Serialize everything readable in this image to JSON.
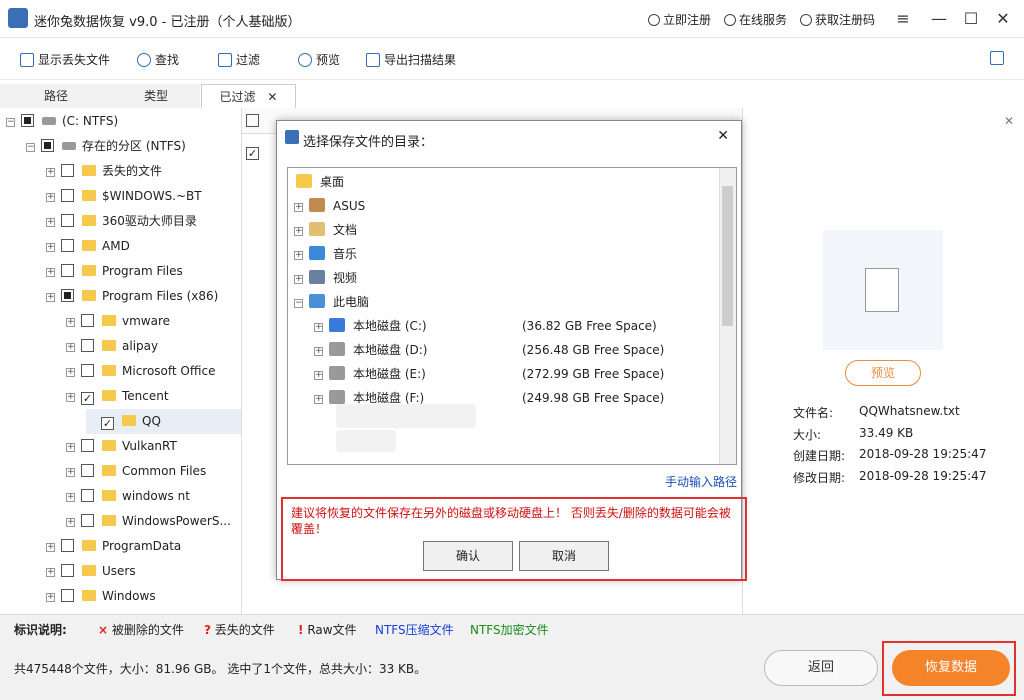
{
  "window": {
    "title": "迷你兔数据恢复  v9.0 - 已注册（个人基础版）",
    "links": [
      "立即注册",
      "在线服务",
      "获取注册码"
    ]
  },
  "toolbar": [
    "显示丢失文件",
    "查找",
    "过滤",
    "预览",
    "导出扫描结果"
  ],
  "tabs": [
    "路径",
    "类型",
    "已过滤"
  ],
  "tree": {
    "root": "(C: NTFS)",
    "partition": "存在的分区 (NTFS)",
    "items": [
      {
        "label": "丢失的文件",
        "level": 2,
        "checked": false
      },
      {
        "label": "$WINDOWS.~BT",
        "level": 2,
        "checked": false
      },
      {
        "label": "360驱动大师目录",
        "level": 2,
        "checked": false
      },
      {
        "label": "AMD",
        "level": 2,
        "checked": false
      },
      {
        "label": "Program Files",
        "level": 2,
        "checked": false
      },
      {
        "label": "Program Files (x86)",
        "level": 2,
        "checked": "partial"
      },
      {
        "label": "vmware",
        "level": 3,
        "checked": false
      },
      {
        "label": "alipay",
        "level": 3,
        "checked": false
      },
      {
        "label": "Microsoft Office",
        "level": 3,
        "checked": false
      },
      {
        "label": "Tencent",
        "level": 3,
        "checked": true
      },
      {
        "label": "QQ",
        "level": 4,
        "checked": true
      },
      {
        "label": "VulkanRT",
        "level": 3,
        "checked": false
      },
      {
        "label": "Common Files",
        "level": 3,
        "checked": false
      },
      {
        "label": "windows nt",
        "level": 3,
        "checked": false
      },
      {
        "label": "WindowsPowerS...",
        "level": 3,
        "checked": false
      },
      {
        "label": "ProgramData",
        "level": 2,
        "checked": false
      },
      {
        "label": "Users",
        "level": 2,
        "checked": false
      },
      {
        "label": "Windows",
        "level": 2,
        "checked": false
      }
    ]
  },
  "dialog": {
    "title": "选择保存文件的目录：",
    "tree": [
      {
        "label": "桌面",
        "icon": "desktop-icon",
        "free": ""
      },
      {
        "label": "ASUS",
        "icon": "user-folder-icon",
        "free": ""
      },
      {
        "label": "文档",
        "icon": "documents-icon",
        "free": ""
      },
      {
        "label": "音乐",
        "icon": "music-icon",
        "free": ""
      },
      {
        "label": "视频",
        "icon": "video-icon",
        "free": ""
      },
      {
        "label": "此电脑",
        "icon": "computer-icon",
        "free": ""
      },
      {
        "label": "本地磁盘 (C:)",
        "icon": "windows-drive-icon",
        "free": "(36.82 GB Free Space)"
      },
      {
        "label": "本地磁盘 (D:)",
        "icon": "drive-icon",
        "free": "(256.48 GB Free Space)"
      },
      {
        "label": "本地磁盘 (E:)",
        "icon": "drive-icon",
        "free": "(272.99 GB Free Space)"
      },
      {
        "label": "本地磁盘 (F:)",
        "icon": "drive-icon",
        "free": "(249.98 GB Free Space)"
      }
    ],
    "manual_link": "手动输入路径",
    "warning": "建议将恢复的文件保存在另外的磁盘或移动硬盘上！ 否则丢失/删除的数据可能会被覆盖！",
    "ok": "确认",
    "cancel": "取消"
  },
  "details": {
    "preview_button": "预览",
    "rows": [
      {
        "label": "文件名:",
        "value": "QQWhatsnew.txt"
      },
      {
        "label": "大小:",
        "value": "33.49 KB"
      },
      {
        "label": "创建日期:",
        "value": "2018-09-28 19:25:47"
      },
      {
        "label": "修改日期:",
        "value": "2018-09-28 19:25:47"
      }
    ]
  },
  "legend": {
    "title": "标识说明:",
    "items": [
      {
        "mark": "×",
        "text": "被删除的文件",
        "color": "#222222"
      },
      {
        "mark": "?",
        "text": "丢失的文件",
        "color": "#222222"
      },
      {
        "mark": "!",
        "text": "Raw文件",
        "color": "#222222"
      },
      {
        "mark": "",
        "text": "NTFS压缩文件",
        "color": "#1a3fd8"
      },
      {
        "mark": "",
        "text": "NTFS加密文件",
        "color": "#1a8a1a"
      }
    ]
  },
  "status": {
    "summary": "共475448个文件，大小：81.96 GB。 选中了1个文件，总共大小：33 KB。",
    "back": "返回",
    "recover": "恢复数据"
  },
  "colors": {
    "accent": "#f5832a",
    "highlight": "#e03030",
    "link": "#1a4fb8"
  }
}
